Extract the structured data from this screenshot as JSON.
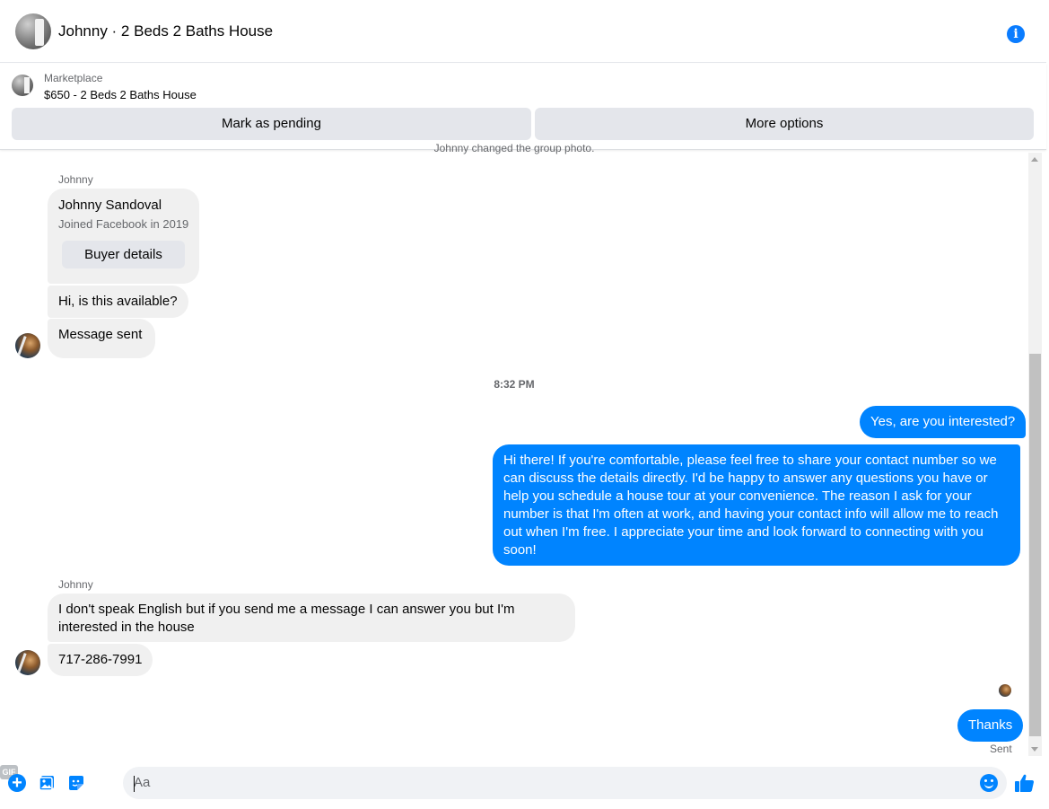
{
  "header": {
    "title": "Johnny · 2 Beds 2 Baths House"
  },
  "listing": {
    "kicker": "Marketplace",
    "title": "$650 - 2 Beds 2 Baths House",
    "mark_pending_label": "Mark as pending",
    "more_options_label": "More options"
  },
  "thread": {
    "system_message": "Johnny changed the group photo.",
    "sender_name_1": "Johnny",
    "card": {
      "name": "Johnny Sandoval",
      "subtitle": "Joined Facebook in 2019",
      "button_label": "Buyer details"
    },
    "msg_available": "Hi, is this available?",
    "msg_sent": "Message sent",
    "timestamp": "8:32 PM",
    "out_interested": "Yes, are you interested?",
    "out_long": "Hi there! If you're comfortable, please feel free to share your contact number so we can discuss the details directly. I'd be happy to answer any questions you have or help you schedule a house tour at your convenience. The reason I ask for your number is that I'm often at work, and having your contact info will allow me to reach out when I'm free. I appreciate your time and look forward to connecting with you soon!",
    "sender_name_2": "Johnny",
    "in_english": "I don't speak English but if you send me a message I can answer you but I'm interested in the house",
    "in_phone": "717-286-7991",
    "out_thanks": "Thanks",
    "status": "Sent"
  },
  "composer": {
    "placeholder": "Aa",
    "gif_label": "GIF"
  },
  "colors": {
    "accent": "#0084ff",
    "bubble_incoming": "#f0f0f0",
    "button_bg": "#e4e6eb"
  },
  "icons": [
    "info-icon",
    "plus-icon",
    "image-icon",
    "sticker-icon",
    "gif-icon",
    "emoji-icon",
    "like-icon"
  ]
}
